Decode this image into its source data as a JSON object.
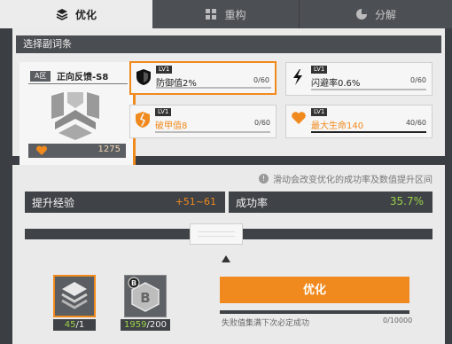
{
  "tabs": [
    {
      "label": "优化",
      "icon": "layers-icon",
      "active": true
    },
    {
      "label": "重构",
      "icon": "blocks-icon",
      "active": false
    },
    {
      "label": "分解",
      "icon": "pie-icon",
      "active": false
    }
  ],
  "upper": {
    "header": "选择副词条",
    "equipment": {
      "area": "A区",
      "name": "正向反馈-S8",
      "value": "1275"
    },
    "stats": [
      {
        "lv": "LV1",
        "name": "防御值2%",
        "progress": "0/60",
        "icon": "shield-icon",
        "selected": true
      },
      {
        "lv": "LV1",
        "name": "闪避率0.6%",
        "progress": "0/60",
        "icon": "lightning-icon",
        "selected": false
      },
      {
        "lv": "LV1",
        "name": "破甲值8",
        "progress": "0/60",
        "icon": "broken-shield-icon",
        "selected": false
      },
      {
        "lv": "LV1",
        "name": "最大生命140",
        "progress": "40/60",
        "icon": "heart-icon",
        "selected": false
      }
    ]
  },
  "lower": {
    "hint": "滑动会改变优化的成功率及数值提升区间",
    "exp_label": "提升经验",
    "exp_value": "+51~61",
    "rate_label": "成功率",
    "rate_value": "35.7%",
    "slider_level": 0.41,
    "items": [
      {
        "have": "45",
        "need": "/1",
        "icon": "stack-icon"
      },
      {
        "have": "1959",
        "need": "/200",
        "icon": "b-coin-icon"
      }
    ],
    "button_label": "优化",
    "fail_label": "失败值集满下次必定成功",
    "fail_count": "0/10000"
  },
  "colors": {
    "accent": "#f08a1e",
    "success": "#9bd24a",
    "panel_dark": "#3f4246"
  }
}
